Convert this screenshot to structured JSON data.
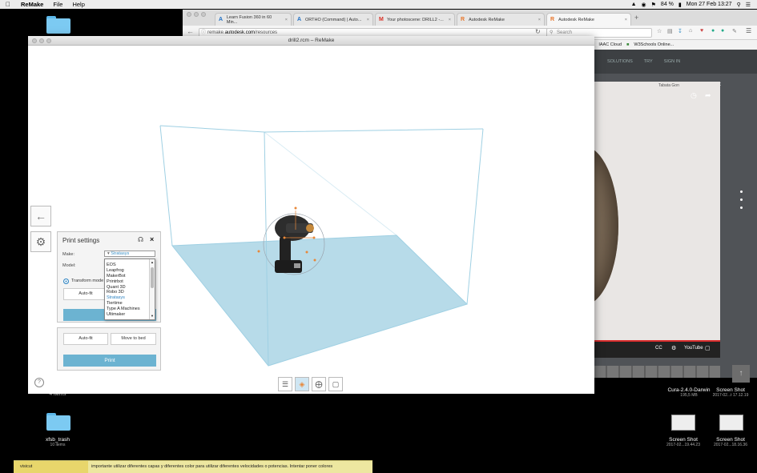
{
  "menubar": {
    "app": "ReMake",
    "items": [
      "File",
      "Help"
    ],
    "battery": "84 %",
    "clock": "Mon 27 Feb 13:27"
  },
  "desktop": {
    "folder1": {
      "name": "xfsb_trash",
      "sub": "10 items"
    },
    "items_label": "4 items",
    "file_cura": {
      "name": "Cura-2.4.0-Darwin",
      "sub": "195,5 MB"
    },
    "shot1": {
      "name": "Screen Shot",
      "sub": "2017-02...19.44.23"
    },
    "shot2": {
      "name": "Screen Shot",
      "sub": "2017-02...18.16.36"
    },
    "shot3": {
      "name": "Screen Shot",
      "sub": "2017-02...t 17.12.19"
    }
  },
  "chrome": {
    "tabs": [
      {
        "label": "Learn Fusion 360 in 60 Min...",
        "icon": "A"
      },
      {
        "label": "ORTHO (Command) | Auto...",
        "icon": "A"
      },
      {
        "label": "Your photoscene: DRILL2 -...",
        "icon": "M"
      },
      {
        "label": "Autodesk ReMake",
        "icon": "R"
      },
      {
        "label": "Autodesk ReMake",
        "icon": "R"
      }
    ],
    "url_prefix": "remake.",
    "url_domain": "autodesk.com",
    "url_path": "/resources",
    "search_placeholder": "Search",
    "bookmarks": [
      "IAAC Cloud",
      "W3Schools Online..."
    ],
    "nav": [
      "SOLUTIONS",
      "TRY",
      "SIGN IN"
    ],
    "video_channel": "Tabata Gon",
    "youtube": "YouTube"
  },
  "remake": {
    "title": "drill2.rcm – ReMake",
    "panel": {
      "title": "Print settings",
      "make_label": "Make:",
      "make_value": "Stratasys",
      "model_label": "Model:",
      "options": [
        "EOS",
        "Leapfrog",
        "MakerBot",
        "Printrbot",
        "Quant 3D",
        "Robo 3D",
        "Stratasys",
        "Tiertime",
        "Type A Machines",
        "Ultimaker"
      ],
      "selected": "Stratasys",
      "transform_label": "Transform mode",
      "autofit": "Auto-fit",
      "autofit2": "Auto-fit",
      "move_to_bed": "Move to bed",
      "print": "Print"
    }
  },
  "note": {
    "title": "visicut",
    "text": "importante utilizar diferentes capas y diferentes color para utilizar diferentes velocidades o potencias. Intentar poner colores"
  },
  "colors": {
    "accent": "#6cb3d1",
    "box": "#9fd0e3",
    "bed": "#b7dbe9"
  }
}
